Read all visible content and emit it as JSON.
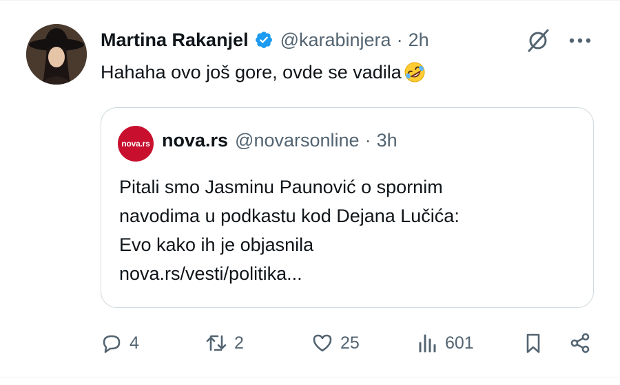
{
  "tweet": {
    "author_name": "Martina Rakanjel",
    "handle": "@karabinjera",
    "separator": "·",
    "time": "2h",
    "text": "Hahaha ovo još gore, ovde se vadila",
    "emoji_icon": "rolling-on-floor-laughing-emoji"
  },
  "quote": {
    "avatar_text": "nova.rs",
    "author_name": "nova.rs",
    "handle": "@novarsonline",
    "separator": "·",
    "time": "3h",
    "lines": [
      "Pitali smo Jasminu Paunović o spornim",
      "navodima u podkastu kod Dejana Lučića:",
      "Evo kako ih je objasnila",
      "nova.rs/vesti/politika..."
    ]
  },
  "actions": {
    "replies": "4",
    "reposts": "2",
    "likes": "25",
    "views": "601"
  },
  "colors": {
    "text_primary": "#0f1419",
    "text_secondary": "#536471",
    "verified_blue": "#1d9bf0",
    "border": "#cfd9de",
    "nova_red": "#c8102e"
  }
}
